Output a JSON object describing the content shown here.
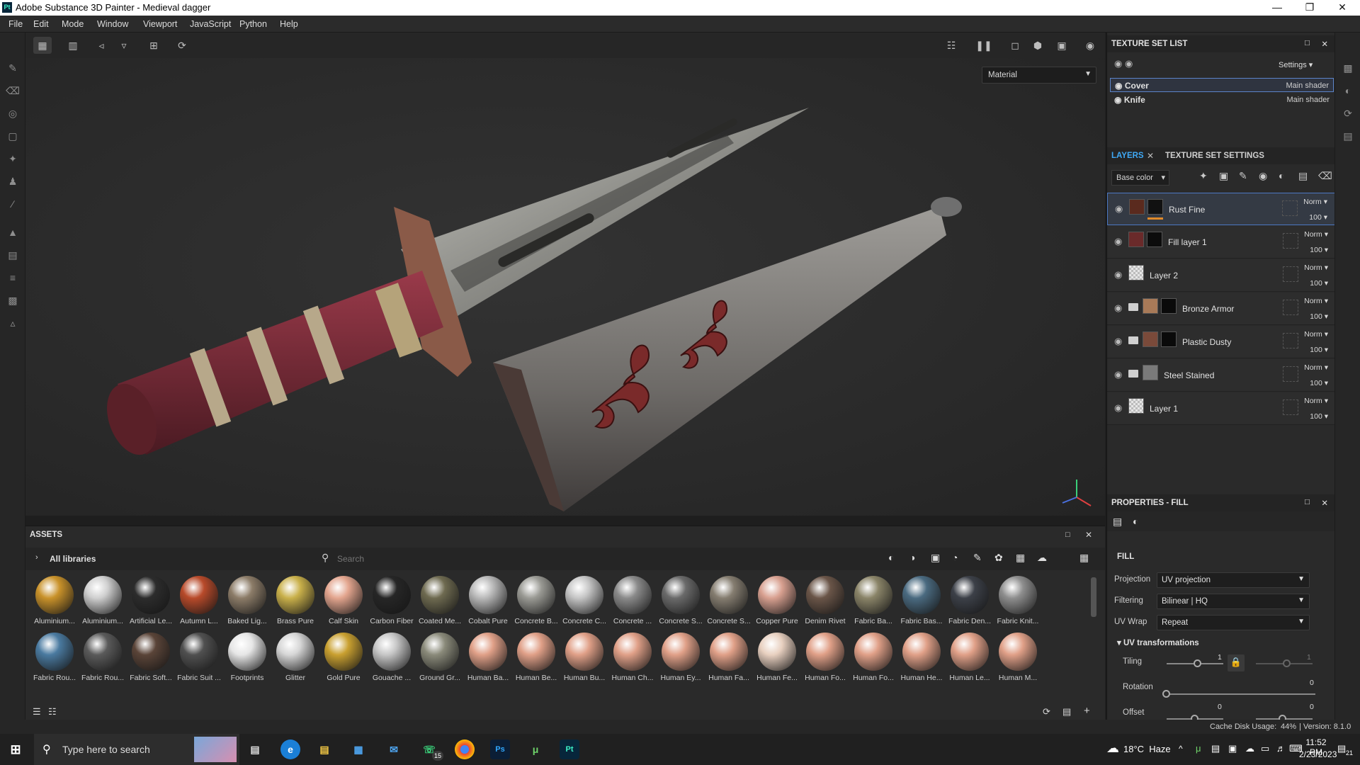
{
  "window": {
    "title": "Adobe Substance 3D Painter - Medieval dagger",
    "app_icon": "Pt"
  },
  "menu": [
    "File",
    "Edit",
    "Mode",
    "Window",
    "Viewport",
    "JavaScript",
    "Python",
    "Help"
  ],
  "viewport": {
    "material_mode": "Material"
  },
  "texture_set_list": {
    "title": "TEXTURE SET LIST",
    "settings_label": "Settings",
    "sets": [
      {
        "name": "Cover",
        "shader": "Main shader"
      },
      {
        "name": "Knife",
        "shader": "Main shader"
      }
    ]
  },
  "layers_panel": {
    "tab_layers": "LAYERS",
    "tab_tss": "TEXTURE SET SETTINGS",
    "channel": "Base color",
    "layers": [
      {
        "name": "Rust Fine",
        "blend": "Norm",
        "opacity": "100"
      },
      {
        "name": "Fill layer 1",
        "blend": "Norm",
        "opacity": "100"
      },
      {
        "name": "Layer 2",
        "blend": "Norm",
        "opacity": "100"
      },
      {
        "name": "Bronze Armor",
        "blend": "Norm",
        "opacity": "100"
      },
      {
        "name": "Plastic Dusty",
        "blend": "Norm",
        "opacity": "100"
      },
      {
        "name": "Steel Stained",
        "blend": "Norm",
        "opacity": "100"
      },
      {
        "name": "Layer 1",
        "blend": "Norm",
        "opacity": "100"
      }
    ]
  },
  "properties": {
    "title": "PROPERTIES - FILL",
    "section": "FILL",
    "projection_label": "Projection",
    "projection": "UV projection",
    "filtering_label": "Filtering",
    "filtering": "Bilinear | HQ",
    "uvwrap_label": "UV Wrap",
    "uvwrap": "Repeat",
    "uvt_label": "UV transformations",
    "tiling_label": "Tiling",
    "tiling_value": "1",
    "tiling_value2": "1",
    "rotation_label": "Rotation",
    "rotation_value": "0",
    "offset_label": "Offset",
    "offset_value": "0",
    "offset_value2": "0"
  },
  "assets": {
    "title": "ASSETS",
    "library": "All libraries",
    "search_placeholder": "Search",
    "row1": [
      {
        "label": "Aluminium...",
        "color": "#c9922a"
      },
      {
        "label": "Aluminium...",
        "color": "#cfcfcf"
      },
      {
        "label": "Artificial Le...",
        "color": "#2c2c2c"
      },
      {
        "label": "Autumn L...",
        "color": "#b84a2a"
      },
      {
        "label": "Baked Lig...",
        "color": "#8c7c68"
      },
      {
        "label": "Brass Pure",
        "color": "#c9b04a"
      },
      {
        "label": "Calf Skin",
        "color": "#e3a58e"
      },
      {
        "label": "Carbon Fiber",
        "color": "#262626"
      },
      {
        "label": "Coated Me...",
        "color": "#6e6a50"
      },
      {
        "label": "Cobalt Pure",
        "color": "#b9b9b9"
      },
      {
        "label": "Concrete B...",
        "color": "#9a9a94"
      },
      {
        "label": "Concrete C...",
        "color": "#c5c5c5"
      },
      {
        "label": "Concrete ...",
        "color": "#8a8a8a"
      },
      {
        "label": "Concrete S...",
        "color": "#6a6a6a"
      },
      {
        "label": "Concrete S...",
        "color": "#857d70"
      },
      {
        "label": "Copper Pure",
        "color": "#d8a090"
      },
      {
        "label": "Denim Rivet",
        "color": "#6a5548"
      },
      {
        "label": "Fabric Ba...",
        "color": "#8a8468"
      },
      {
        "label": "Fabric Bas...",
        "color": "#4a6a80"
      },
      {
        "label": "Fabric Den...",
        "color": "#3c4048"
      },
      {
        "label": "Fabric Knit...",
        "color": "#8e8e8e"
      }
    ],
    "row2": [
      {
        "label": "Fabric Rou...",
        "color": "#4a7aa0"
      },
      {
        "label": "Fabric Rou...",
        "color": "#5a5a5a"
      },
      {
        "label": "Fabric Soft...",
        "color": "#5a4438"
      },
      {
        "label": "Fabric Suit ...",
        "color": "#505050"
      },
      {
        "label": "Footprints",
        "color": "#e6e6e6"
      },
      {
        "label": "Glitter",
        "color": "#d6d6d6"
      },
      {
        "label": "Gold Pure",
        "color": "#c9a030"
      },
      {
        "label": "Gouache ...",
        "color": "#c6c6c6"
      },
      {
        "label": "Ground Gr...",
        "color": "#8a8a7a"
      },
      {
        "label": "Human Ba...",
        "color": "#e0a088"
      },
      {
        "label": "Human Be...",
        "color": "#e0a088"
      },
      {
        "label": "Human Bu...",
        "color": "#e0a088"
      },
      {
        "label": "Human Ch...",
        "color": "#e0a088"
      },
      {
        "label": "Human Ey...",
        "color": "#e0a088"
      },
      {
        "label": "Human Fa...",
        "color": "#e0a088"
      },
      {
        "label": "Human Fe...",
        "color": "#e8d0c0"
      },
      {
        "label": "Human Fo...",
        "color": "#e0a088"
      },
      {
        "label": "Human Fo...",
        "color": "#e0a088"
      },
      {
        "label": "Human He...",
        "color": "#e0a088"
      },
      {
        "label": "Human Le...",
        "color": "#e0a088"
      },
      {
        "label": "Human M...",
        "color": "#e0a088"
      }
    ]
  },
  "status": {
    "cache": "Cache Disk Usage:",
    "cache_pct": "44%",
    "version": "| Version: 8.1.0"
  },
  "taskbar": {
    "search_placeholder": "Type here to search",
    "weather": "18°C  Haze",
    "time": "11:52 PM",
    "date": "2/23/2023",
    "whatsapp_badge": "15",
    "notif_count": "21"
  }
}
